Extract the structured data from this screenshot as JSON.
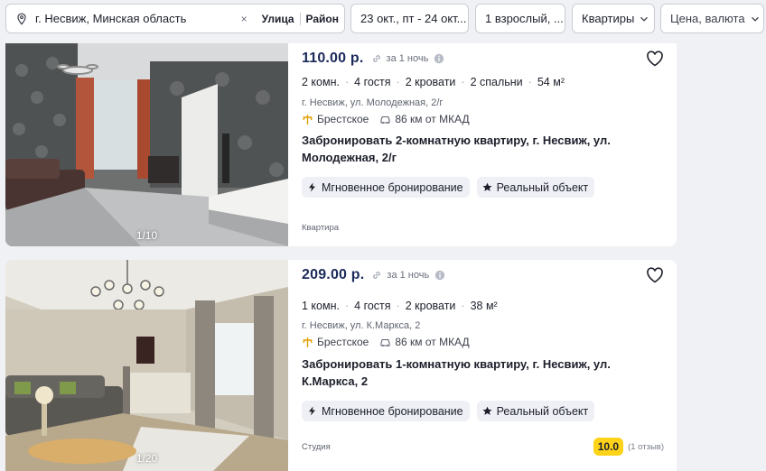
{
  "search": {
    "location": "г. Несвиж, Минская область",
    "clear": "×",
    "street_label": "Улица",
    "district_label": "Район",
    "dates": "23 окт., пт - 24 окт...",
    "guests": "1 взрослый, ...",
    "property_type": "Квартиры",
    "price": "Цена, валюта"
  },
  "listings": [
    {
      "price": "110.00 р.",
      "per_night": "за 1 ночь",
      "rooms": "2 комн.",
      "guests": "4 гостя",
      "beds": "2 кровати",
      "bedrooms": "2 спальни",
      "area": "54 м²",
      "address": "г. Несвиж, ул. Молодежная, 2/г",
      "direction": "Брестское",
      "distance": "86 км от МКАД",
      "title": "Забронировать 2-комнатную квартиру, г. Несвиж, ул. Молодежная, 2/г",
      "tag_instant": "Мгновенное бронирование",
      "tag_real": "Реальный объект",
      "kind": "Квартира",
      "photo_counter": "1/10"
    },
    {
      "price": "209.00 р.",
      "per_night": "за 1 ночь",
      "rooms": "1 комн.",
      "guests": "4 гостя",
      "beds": "2 кровати",
      "area": "38 м²",
      "address": "г. Несвиж, ул. К.Маркса, 2",
      "direction": "Брестское",
      "distance": "86 км от МКАД",
      "title": "Забронировать 1-комнатную квартиру, г. Несвиж, ул. К.Маркса, 2",
      "tag_instant": "Мгновенное бронирование",
      "tag_real": "Реальный объект",
      "kind": "Студия",
      "rating": "10.0",
      "reviews": "(1 отзыв)",
      "photo_counter": "1/20"
    }
  ],
  "colors": {
    "price": "#1b2a5a",
    "rating_badge": "#ffd31a",
    "tag_bg": "#eef0f5",
    "page_bg": "#f0f1f5"
  }
}
